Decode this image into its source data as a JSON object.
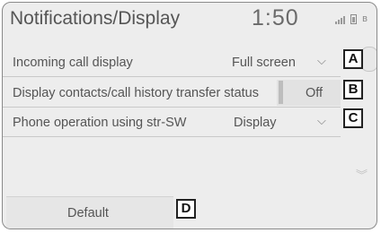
{
  "header": {
    "title": "Notifications/Display",
    "clock": "1:50",
    "icons": [
      "signal-icon",
      "battery-icon",
      "bluetooth-icon"
    ]
  },
  "settings": [
    {
      "label": "Incoming call display",
      "value": "Full screen",
      "control": "dropdown",
      "callout": "A"
    },
    {
      "label": "Display contacts/call history transfer status",
      "value": "Off",
      "control": "toggle",
      "callout": "B"
    },
    {
      "label": "Phone operation using str-SW",
      "value": "Display",
      "control": "dropdown",
      "callout": "C"
    }
  ],
  "footer": {
    "default_label": "Default",
    "callout": "D"
  },
  "glyphs": {
    "chevron": "⌵",
    "scroll_down": "︾",
    "bluetooth": "ʙ"
  },
  "colors": {
    "screen_bg": "#ededed",
    "text": "#555555",
    "callout_border": "#222222"
  }
}
